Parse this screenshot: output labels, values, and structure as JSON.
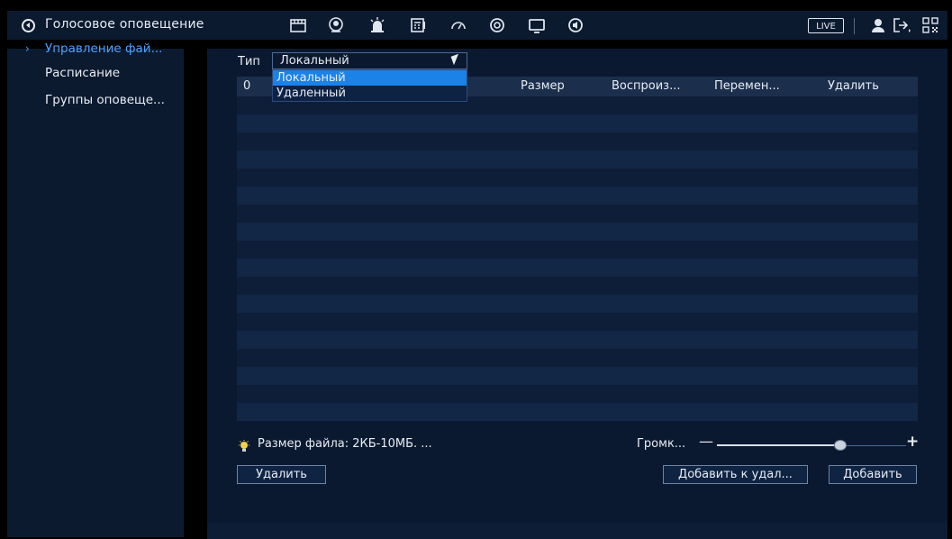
{
  "topbar": {
    "title": "Голосовое оповещение",
    "live_label": "LIVE",
    "icons": [
      "speaker-icon",
      "film-icon",
      "face-icon",
      "alarm-light-icon",
      "calculator-icon",
      "gauge-icon",
      "sync-icon",
      "monitor-icon",
      "audio-icon",
      "user-icon",
      "logout-icon",
      "qr-code-icon"
    ]
  },
  "sidebar": {
    "items": [
      {
        "label": "Управление фай...",
        "active": true
      },
      {
        "label": "Расписание",
        "active": false
      },
      {
        "label": "Группы оповеще...",
        "active": false
      }
    ]
  },
  "main": {
    "type_label": "Тип",
    "type_value": "Локальный",
    "dropdown_options": [
      "Локальный",
      "Удаленный"
    ],
    "table": {
      "columns": [
        "0",
        "Размер",
        "Воспроиз...",
        "Перемен...",
        "Удалить"
      ],
      "rows": []
    },
    "hint": "Размер файла: 2КБ-10МБ. ...",
    "volume_label": "Громк...",
    "volume_level": 0.65,
    "buttons": {
      "delete": "Удалить",
      "add_to_remote": "Добавить к удал...",
      "add": "Добавить"
    }
  },
  "colors": {
    "accent": "#4da3ff",
    "selection": "#1b82e8",
    "panel": "#0c1a2f"
  }
}
